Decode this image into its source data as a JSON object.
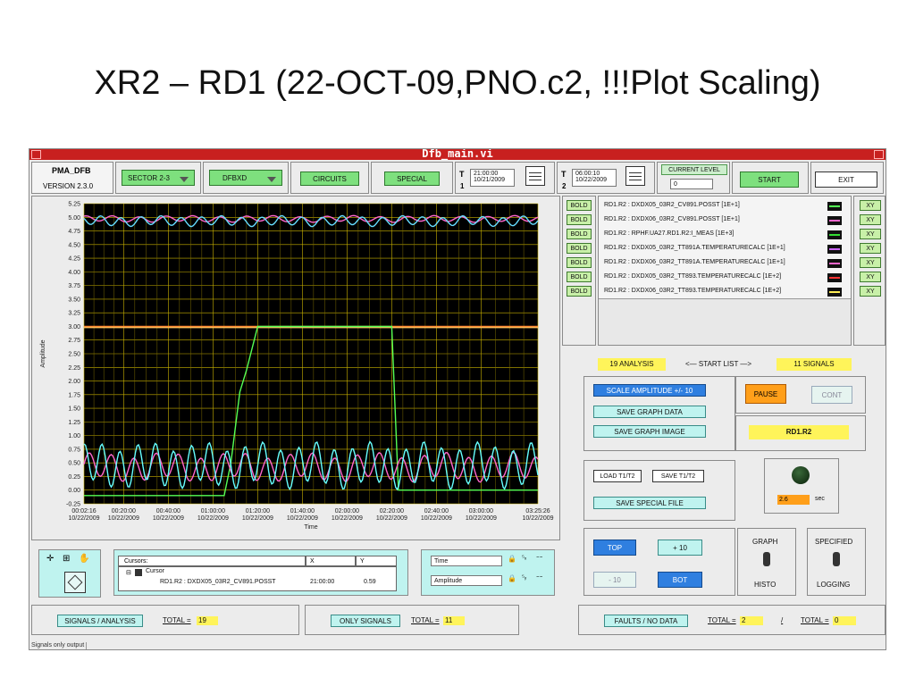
{
  "slide_title": "XR2 – RD1 (22-OCT-09,PNO.c2, !!!Plot Scaling)",
  "window": {
    "title": "Dfb_main.vi"
  },
  "header": {
    "app_name": "PMA_DFB",
    "version": "VERSION 2.3.0",
    "sector": "SECTOR 2-3",
    "dfbxd": "DFBXD",
    "circuits": "CIRCUITS",
    "special": "SPECIAL",
    "t1_label": "T",
    "t1_num": "1",
    "t1_time": "21:00:00",
    "t1_date": "10/21/2009",
    "t2_label": "T",
    "t2_num": "2",
    "t2_time": "06:00:10",
    "t2_date": "10/22/2009",
    "current_level_label": "CURRENT LEVEL",
    "current_level_value": "0",
    "start": "START",
    "exit": "EXIT"
  },
  "chart_data": {
    "type": "line",
    "ylabel": "Amplitude",
    "xlabel": "Time",
    "ylim": [
      -0.25,
      5.25
    ],
    "y_ticks": [
      "5.25",
      "5.00",
      "4.75",
      "4.50",
      "4.25",
      "4.00",
      "3.75",
      "3.50",
      "3.25",
      "3.00",
      "2.75",
      "2.50",
      "2.25",
      "2.00",
      "1.75",
      "1.50",
      "1.25",
      "1.00",
      "0.75",
      "0.50",
      "0.25",
      "0.00",
      "-0.25"
    ],
    "x_ticks": [
      {
        "time": "00:02:16",
        "date": "10/22/2009"
      },
      {
        "time": "00:20:00",
        "date": "10/22/2009"
      },
      {
        "time": "00:40:00",
        "date": "10/22/2009"
      },
      {
        "time": "01:00:00",
        "date": "10/22/2009"
      },
      {
        "time": "01:20:00",
        "date": "10/22/2009"
      },
      {
        "time": "01:40:00",
        "date": "10/22/2009"
      },
      {
        "time": "02:00:00",
        "date": "10/22/2009"
      },
      {
        "time": "02:20:00",
        "date": "10/22/2009"
      },
      {
        "time": "02:40:00",
        "date": "10/22/2009"
      },
      {
        "time": "03:00:00",
        "date": "10/22/2009"
      },
      {
        "time": "03:25:26",
        "date": "10/22/2009"
      }
    ],
    "x_minutes": [
      2.27,
      20,
      40,
      60,
      80,
      100,
      120,
      140,
      160,
      180,
      205.43
    ],
    "series": [
      {
        "color": "#ff66cc",
        "kind": "wave",
        "base": 4.97,
        "amp": 0.05,
        "period": 12
      },
      {
        "color": "#66ddff",
        "kind": "wave",
        "base": 4.93,
        "amp": 0.08,
        "period": 9
      },
      {
        "color": "#ffcc66",
        "kind": "flat",
        "value": 2.98
      },
      {
        "color": "#ff8a33",
        "kind": "flat",
        "value": 3.0
      },
      {
        "color": "#55ff55",
        "kind": "step",
        "points": [
          [
            2.27,
            -0.1
          ],
          [
            65,
            -0.1
          ],
          [
            68,
            0.5
          ],
          [
            72,
            1.8
          ],
          [
            75,
            2.2
          ],
          [
            80,
            3.0
          ],
          [
            140,
            3.0
          ],
          [
            143,
            0.0
          ],
          [
            205.43,
            0.0
          ]
        ]
      },
      {
        "color": "#ff66cc",
        "kind": "wave",
        "base": 0.42,
        "amp": 0.22,
        "period": 10
      },
      {
        "color": "#66ffff",
        "kind": "wave",
        "base": 0.45,
        "amp": 0.35,
        "period": 8
      }
    ]
  },
  "signals": {
    "bold_label": "BOLD",
    "xy_label": "XY",
    "items": [
      {
        "text": "RD1.R2 : DXDX05_03R2_CV891.POSST [1E+1]",
        "color": "#55ff55"
      },
      {
        "text": "RD1.R2 : DXDX06_03R2_CV891.POSST [1E+1]",
        "color": "#ff66cc"
      },
      {
        "text": "RD1.R2 : RPHF.UA27.RD1.R2:I_MEAS [1E+3]",
        "color": "#33dd33"
      },
      {
        "text": "RD1.R2 : DXDX05_03R2_TT891A.TEMPERATURECALC [1E+1]",
        "color": "#cc66ff"
      },
      {
        "text": "RD1.R2 : DXDX06_03R2_TT891A.TEMPERATURECALC [1E+1]",
        "color": "#ff66cc"
      },
      {
        "text": "RD1.R2 : DXDX05_03R2_TT893.TEMPERATURECALC [1E+2]",
        "color": "#ff3333"
      },
      {
        "text": "RD1.R2 : DXDX06_03R2_TT893.TEMPERATURECALC [1E+2]",
        "color": "#ffee55"
      }
    ]
  },
  "controls": {
    "analysis_count": "19 ANALYSIS",
    "start_list": "<— START LIST —>",
    "signal_count": "11 SIGNALS",
    "scale_amplitude": "SCALE AMPLITUDE +/- 10",
    "save_graph_data": "SAVE GRAPH DATA",
    "save_graph_image": "SAVE GRAPH IMAGE",
    "pause": "PAUSE",
    "cont": "CONT",
    "circuit_name": "RD1.R2",
    "load_t1t2": "LOAD T1/T2",
    "save_t1t2": "SAVE T1/T2",
    "save_special_file": "SAVE SPECIAL FILE",
    "interval_value": "2.6",
    "interval_unit": "sec",
    "top": "TOP",
    "plus10": "+ 10",
    "minus10": "- 10",
    "bot": "BOT",
    "graph": "GRAPH",
    "histo": "HISTO",
    "specified": "SPECIFIED",
    "logging": "LOGGING"
  },
  "cursors": {
    "label": "Cursors:",
    "col_x": "X",
    "col_y": "Y",
    "cursor_name": "Cursor",
    "signal": "RD1.R2 : DXDX05_03R2_CV891.POSST",
    "x_value": "21:00:00",
    "y_value": "0.59"
  },
  "scales": {
    "time_label": "Time",
    "amplitude_label": "Amplitude"
  },
  "footer": {
    "signals_analysis": "SIGNALS / ANALYSIS",
    "total_label": "TOTAL =",
    "total_sa": "19",
    "only_signals": "ONLY SIGNALS",
    "total_os": "11",
    "faults": "FAULTS / NO DATA",
    "total_faults": "2",
    "slash": "/",
    "total_nodata": "0",
    "status": "Signals only output"
  }
}
